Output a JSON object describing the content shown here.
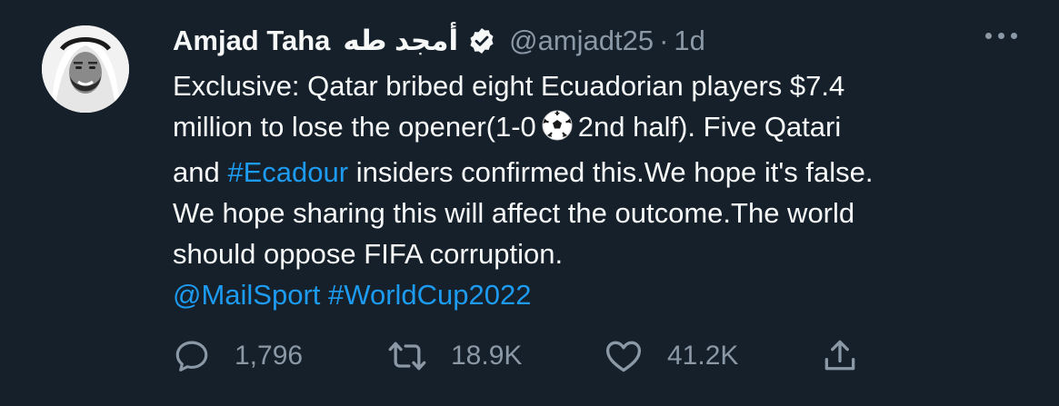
{
  "author": {
    "name": "Amjad Taha",
    "name_arabic": "أمجد طه",
    "handle": "@amjadt25",
    "separator": "·",
    "time": "1d",
    "verified_icon": "verified-badge-icon",
    "avatar_icon": "profile-photo"
  },
  "tweet": {
    "line1": "Exclusive: Qatar bribed eight Ecuadorian players $7.4",
    "line2_part1": "million to lose the opener(1-0",
    "line2_emoji": "soccer-ball-icon",
    "line2_part2": "2nd half). Five Qatari",
    "line3_part1": "and",
    "line3_hashtag": "#Ecadour",
    "line3_part2": "insiders confirmed this.We hope it's false.",
    "line4": "We hope sharing this will affect the outcome.The world",
    "line5": "should oppose FIFA corruption.",
    "mention": "@MailSport",
    "hashtag2": "#WorldCup2022"
  },
  "actions": {
    "replies": "1,796",
    "retweets": "18.9K",
    "likes": "41.2K"
  },
  "colors": {
    "background": "#15202b",
    "text": "#f7f9f9",
    "secondary": "#8b98a5",
    "link": "#1d9bf0"
  }
}
